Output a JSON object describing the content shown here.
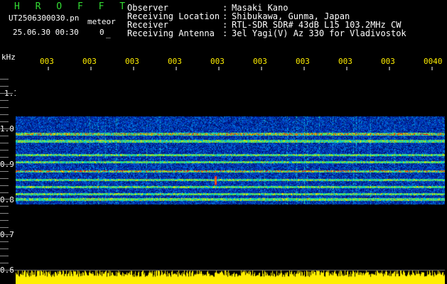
{
  "app": {
    "title": "H R O F F T",
    "filename": "UT2506300030.pn",
    "mode": "meteor",
    "datetime": "25.06.30 00:30",
    "count": "0",
    "count_suffix": "_"
  },
  "info": [
    {
      "key": "Observer",
      "sep": ":",
      "value": "Masaki Kano"
    },
    {
      "key": "Receiving Location",
      "sep": ":",
      "value": "Shibukawa, Gunma, Japan"
    },
    {
      "key": "Receiver",
      "sep": ":",
      "value": "RTL-SDR SDR# 43dB L15 103.2MHz CW"
    },
    {
      "key": "Receiving Antenna",
      "sep": ":",
      "value": "3el Yagi(V) Az 330 for Vladivostok"
    }
  ],
  "axes": {
    "y_unit": "kHz",
    "y_ticks": [
      "1.0",
      "0.9",
      "0.8",
      "0.7",
      "0.6"
    ],
    "y_minor": [
      "1.1"
    ],
    "x_ticks": [
      "003",
      "003",
      "003",
      "003",
      "003",
      "003",
      "003",
      "003",
      "003",
      "0040"
    ]
  },
  "colors": {
    "background": "#000000",
    "header_text": "#ffffff",
    "title": "#33dd33",
    "tick_x": "#ffee00",
    "waterfall_base": "#000a55",
    "signal_hot": "#ff2020",
    "eq_bar": "#ffee00"
  },
  "chart_data": {
    "type": "heatmap",
    "y_unit": "kHz",
    "ylim": [
      0.6,
      1.15
    ],
    "noise_band": [
      0.785,
      1.035
    ],
    "strong_lines_khz": [
      0.985,
      0.965,
      0.925,
      0.905,
      0.88,
      0.855,
      0.835,
      0.815,
      0.8
    ],
    "hot_lines_khz": [
      0.985,
      0.88
    ],
    "meteor_khz": [
      0.84,
      0.865
    ]
  }
}
